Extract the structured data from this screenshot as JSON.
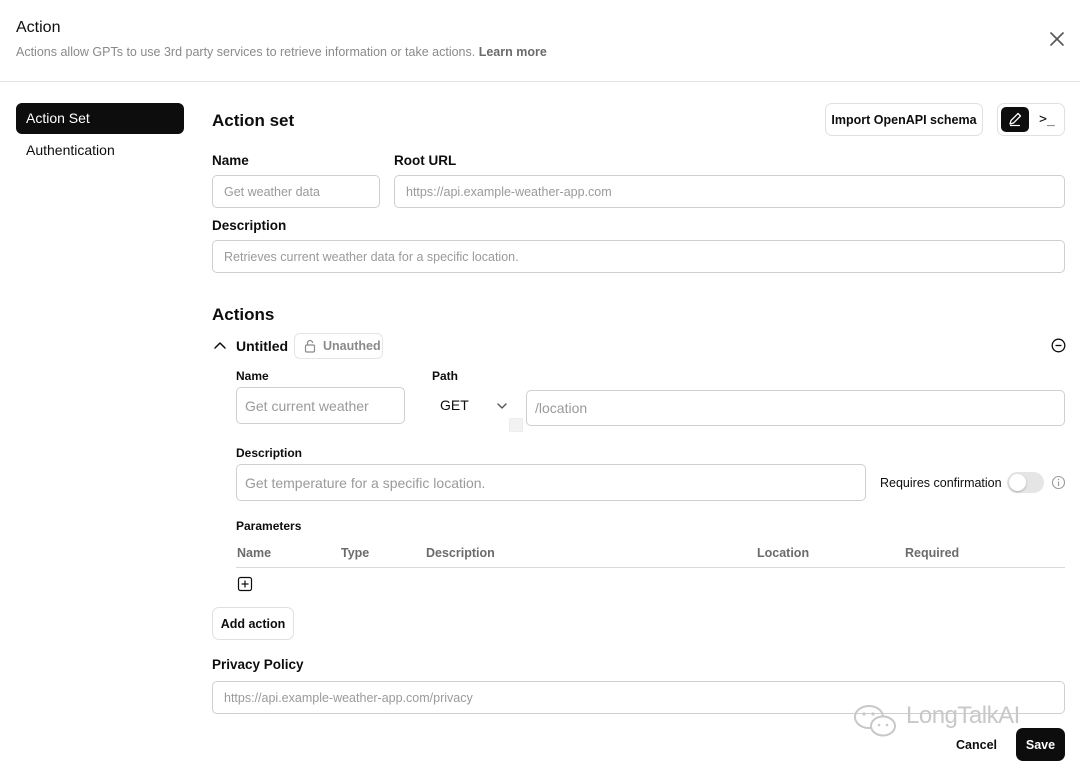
{
  "header": {
    "title": "Action",
    "subtitle": "Actions allow GPTs to use 3rd party services to retrieve information or take actions.",
    "learn_more": "Learn more"
  },
  "sidebar": {
    "items": [
      {
        "label": "Action Set",
        "active": true
      },
      {
        "label": "Authentication",
        "active": false
      }
    ]
  },
  "action_set": {
    "title": "Action set",
    "import_button": "Import OpenAPI schema",
    "name_label": "Name",
    "name_placeholder": "Get weather data",
    "root_url_label": "Root URL",
    "root_url_placeholder": "https://api.example-weather-app.com",
    "description_label": "Description",
    "description_placeholder": "Retrieves current weather data for a specific location."
  },
  "actions": {
    "title": "Actions",
    "item": {
      "title": "Untitled",
      "auth_badge": "Unauthed",
      "name_label": "Name",
      "name_placeholder": "Get current weather",
      "path_label": "Path",
      "method": "GET",
      "path_placeholder": "/location",
      "description_label": "Description",
      "description_placeholder": "Get temperature for a specific location.",
      "requires_confirmation_label": "Requires confirmation",
      "requires_confirmation": false,
      "parameters_label": "Parameters",
      "param_columns": [
        "Name",
        "Type",
        "Description",
        "Location",
        "Required"
      ]
    },
    "add_action": "Add action"
  },
  "privacy": {
    "label": "Privacy Policy",
    "placeholder": "https://api.example-weather-app.com/privacy"
  },
  "footer": {
    "cancel": "Cancel",
    "save": "Save"
  },
  "watermark": "LongTalkAI",
  "icons": [
    "close-icon",
    "pencil-icon",
    "terminal-icon",
    "chevron-up-icon",
    "lock-icon",
    "minus-circle-icon",
    "chevron-down-icon",
    "info-icon",
    "plus-square-icon",
    "wechat-icon"
  ],
  "colors": {
    "primary": "#0d0d0d",
    "muted": "#8a8a8a",
    "border": "#cfcfcf"
  }
}
